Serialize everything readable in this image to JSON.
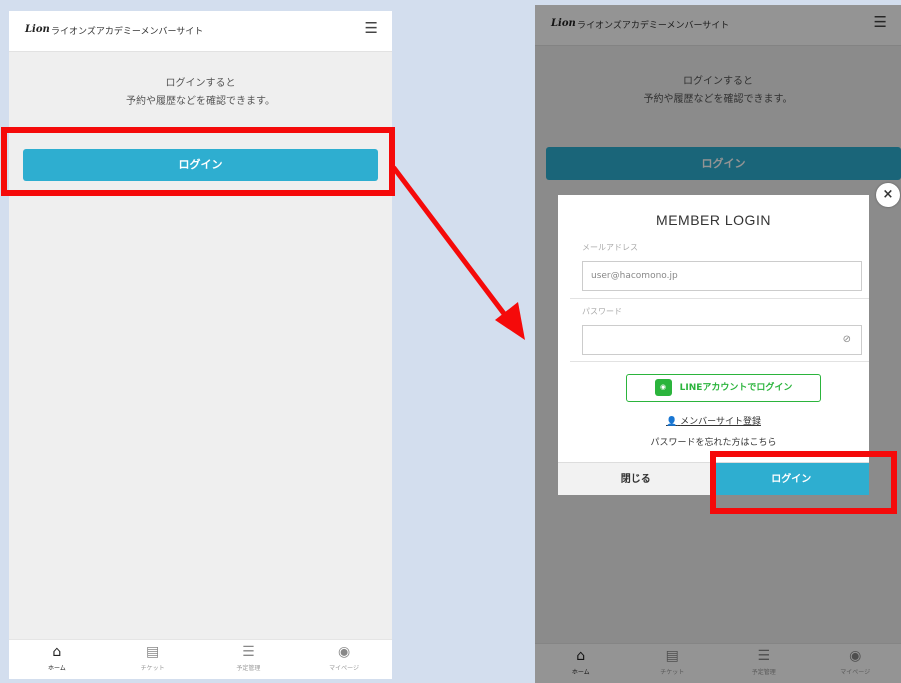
{
  "app": {
    "logo": "Lion",
    "site_title": "ライオンズアカデミーメンバーサイト",
    "menu_icon": "hamburger-menu-icon"
  },
  "home": {
    "message_line1": "ログインすると",
    "message_line2": "予約や履歴などを確認できます。",
    "login_button": "ログイン"
  },
  "tabs": [
    {
      "label": "ホーム",
      "icon": "home-icon"
    },
    {
      "label": "チケット",
      "icon": "ticket-icon"
    },
    {
      "label": "予定管理",
      "icon": "list-icon"
    },
    {
      "label": "マイページ",
      "icon": "user-icon"
    }
  ],
  "modal": {
    "title": "MEMBER LOGIN",
    "email_label": "メールアドレス",
    "email_placeholder": "user@hacomono.jp",
    "password_label": "パスワード",
    "line_button": "LINEアカウントでログイン",
    "register_link": "メンバーサイト登録",
    "forgot_link": "パスワードを忘れた方はこちら",
    "close_button": "閉じる",
    "login_button": "ログイン",
    "close_icon": "×"
  },
  "colors": {
    "accent": "#2eaed0",
    "highlight": "#f50a0a",
    "line_green": "#2bb43c"
  }
}
